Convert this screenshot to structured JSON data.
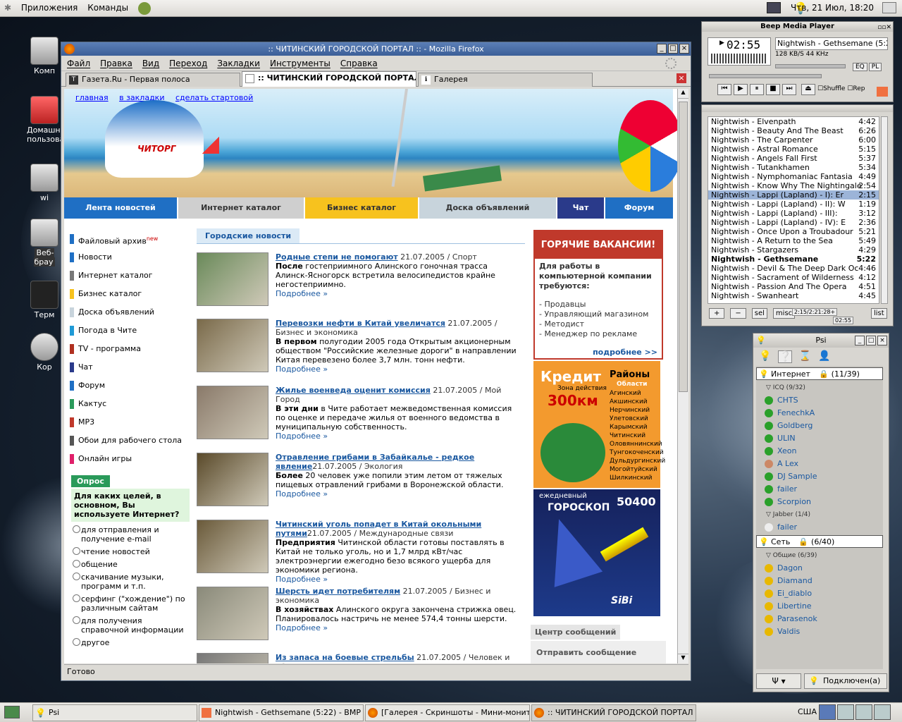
{
  "top_panel": {
    "apps": "Приложения",
    "commands": "Команды",
    "clock": "Чтв, 21 Июл, 18:20"
  },
  "desktop_icons": [
    "Комп",
    "Домашни пользова",
    "Веб-брау",
    "Терм",
    "Кор",
    "wi"
  ],
  "firefox": {
    "title": ":: ЧИТИНСКИЙ ГОРОДСКОЙ ПОРТАЛ :: - Mozilla Firefox",
    "menu": [
      "Файл",
      "Правка",
      "Вид",
      "Переход",
      "Закладки",
      "Инструменты",
      "Справка"
    ],
    "tabs": [
      "Газета.Ru - Первая полоса",
      ":: ЧИТИНСКИЙ ГОРОДСКОЙ ПОРТАЛ ::",
      "Галерея"
    ],
    "status": "Готово"
  },
  "page": {
    "top_links": [
      "главная",
      "в закладки",
      "сделать стартовой"
    ],
    "banner_brand": "ЧИТОРГ",
    "nav": [
      {
        "label": "Лента новостей",
        "bg": "#1f6fc4",
        "fg": "#fff"
      },
      {
        "label": "Интернет каталог",
        "bg": "#cfcfcf",
        "fg": "#333"
      },
      {
        "label": "Бизнес каталог",
        "bg": "#f7c21e",
        "fg": "#333"
      },
      {
        "label": "Доска объявлений",
        "bg": "#c8d4dc",
        "fg": "#333"
      },
      {
        "label": "Чат",
        "bg": "#2a3a8a",
        "fg": "#fff"
      },
      {
        "label": "Форум",
        "bg": "#1f6fc4",
        "fg": "#fff"
      }
    ],
    "left_menu": [
      {
        "label": "Файловый архив",
        "color": "#1f6fc4",
        "badge": "new"
      },
      {
        "label": "Новости",
        "color": "#1f6fc4"
      },
      {
        "label": "Интернет каталог",
        "color": "#777"
      },
      {
        "label": "Бизнес каталог",
        "color": "#f7c21e"
      },
      {
        "label": "Доска объявлений",
        "color": "#c8d4dc"
      },
      {
        "label": "Погода в Чите",
        "color": "#1f9ad6"
      },
      {
        "label": "TV - программа",
        "color": "#b03020"
      },
      {
        "label": "Чат",
        "color": "#2a3a8a"
      },
      {
        "label": "Форум",
        "color": "#1f6fc4"
      },
      {
        "label": "Кактус",
        "color": "#2a9a5a"
      },
      {
        "label": "MP3",
        "color": "#c0392b"
      },
      {
        "label": "Обои для рабочего стола",
        "color": "#555"
      },
      {
        "label": "Онлайн игры",
        "color": "#e0206a"
      }
    ],
    "poll": {
      "header": "Опрос",
      "question": "Для каких целей, в основном, Вы используете Интернет?",
      "options": [
        "для отправления и получение e-mail",
        "чтение новостей",
        "общение",
        "скачивание музыки, программ и т.п.",
        "серфинг (\"хождение\") по различным сайтам",
        "для получения справочной информации",
        "другое"
      ]
    },
    "news_header": "Городские новости",
    "news": [
      {
        "title": "Родные степи не помогают",
        "meta": " 21.07.2005 / Спорт",
        "lead": "После",
        "body": " гостеприимного Алинского гоночная трасса Алинск-Ясногорск встретила велосипедистов крайне негостеприимно.",
        "more": "Подробнее »",
        "thumb": "#6a8a5a"
      },
      {
        "title": "Перевозки нефти в Китай увеличатся",
        "meta": " 21.07.2005 / Бизнес и экономика",
        "lead": "В первом",
        "body": " полугодии 2005 года Открытым акционерным обществом \"Российские железные дороги\" в направлении Китая перевезено более 3,7 млн. тонн нефти.",
        "more": "Подробнее »",
        "thumb": "#7a6a4a"
      },
      {
        "title": "Жилье военведа оценит комиссия",
        "meta": " 21.07.2005 / Мой Город",
        "lead": "В эти дни",
        "body": " в Чите работает межведомственная комиссия по оценке и передаче жилья от военного ведомства в муниципальную собственность.",
        "more": "Подробнее »",
        "thumb": "#8a7a6a"
      },
      {
        "title": "Отравление грибами в Забайкалье - редкое явление",
        "meta": "21.07.2005 / Экология",
        "lead": "Более",
        "body": " 20 человек уже попили этим летом от тяжелых пищевых отравлений грибами в Воронежской области.",
        "more": "Подробнее »",
        "thumb": "#5a4a2a"
      },
      {
        "title": "Читинский уголь попадет в Китай окольными путями",
        "meta": "21.07.2005 / Международные связи",
        "lead": "Предприятия",
        "body": " Читинской области готовы поставлять в Китай не только уголь, но и 1,7 млрд кВт/час электроэнергии ежегодно безо всякого ущерба для экономики региона.",
        "more": "Подробнее »",
        "thumb": "#6a5a3a"
      },
      {
        "title": "Шерсть идет потребителям",
        "meta": " 21.07.2005 / Бизнес и экономика",
        "lead": "В хозяйствах",
        "body": " Алинского округа закончена стрижка овец. Планировалось настричь не менее 574,4 тонны шерсти.",
        "more": "Подробнее »",
        "thumb": "#8a8a7a"
      },
      {
        "title": "Из запаса на боевые стрельбы",
        "meta": " 21.07.2005 / Человек и общество",
        "lead": "",
        "body": "",
        "more": "",
        "thumb": "#777"
      }
    ],
    "vacancies": {
      "header": "ГОРЯЧИЕ ВАКАНСИИ!",
      "intro": "Для работы в компьютерной компании требуются:",
      "items": [
        "- Продавцы",
        "- Управляющий магазином",
        "- Методист",
        "- Менеджер по рекламе"
      ],
      "more": "подробнее >>"
    },
    "kredit": {
      "title": "Кредит",
      "zone": "Зона действия",
      "km": "300км",
      "regions_title": "Районы",
      "regions_sub": "Области",
      "regions": [
        "Агинский",
        "Акшинский",
        "Нерчинский",
        "Улетовский",
        "Карымский",
        "Читинский",
        "Оловяннинский",
        "Тунгокоченский",
        "Дульдургинский",
        "Могойтуйский",
        "Шилкинский"
      ]
    },
    "horo": {
      "daily": "ежедневный",
      "title": "ГОРОСКОП",
      "number": "50400",
      "brand": "SiBi"
    },
    "msg_center": {
      "title": "Центр сообщений",
      "send": "Отправить сообщение"
    }
  },
  "bmp": {
    "title": "Beep Media Player",
    "time": "02:55",
    "track": "Nightwish - Gethsemane (5:22)",
    "info": "128 KB/S  44 KHz",
    "shuffle": "Shuffle",
    "repeat": "Rep",
    "eq": "EQ",
    "pl": "PL"
  },
  "playlist": {
    "tracks": [
      [
        "Nightwish - Elvenpath",
        "4:42"
      ],
      [
        "Nightwish - Beauty And The Beast",
        "6:26"
      ],
      [
        "Nightwish - The Carpenter",
        "6:00"
      ],
      [
        "Nightwish - Astral Romance",
        "5:15"
      ],
      [
        "Nightwish - Angels Fall First",
        "5:37"
      ],
      [
        "Nightwish - Tutankhamen",
        "5:34"
      ],
      [
        "Nightwish - Nymphomaniac Fantasia",
        "4:49"
      ],
      [
        "Nightwish - Know Why The Nightingale",
        "2:54"
      ],
      [
        "Nightwish - Lappi (Lapland) - I): Er",
        "2:15"
      ],
      [
        "Nightwish - Lappi (Lapland) - II): W",
        "1:19"
      ],
      [
        "Nightwish - Lappi (Lapland) - III):",
        "3:12"
      ],
      [
        "Nightwish - Lappi (Lapland) - IV): E",
        "2:36"
      ],
      [
        "Nightwish - Once Upon a Troubadour",
        "5:21"
      ],
      [
        "Nightwish - A Return to the Sea",
        "5:49"
      ],
      [
        "Nightwish - Stargazers",
        "4:29"
      ],
      [
        "Nightwish - Gethsemane",
        "5:22"
      ],
      [
        "Nightwish - Devil & The Deep Dark Oc",
        "4:46"
      ],
      [
        "Nightwish - Sacrament of Wilderness",
        "4:12"
      ],
      [
        "Nightwish - Passion And The Opera",
        "4:51"
      ],
      [
        "Nightwish - Swanheart",
        "4:45"
      ]
    ],
    "selected_index": 8,
    "current_index": 15,
    "buttons": [
      "+",
      "−",
      "sel",
      "misc",
      "list"
    ],
    "time_info": "2:15/2:21:28+",
    "pos": "02:55"
  },
  "psi": {
    "title": "Psi",
    "account1": "Интернет",
    "count1": "(11/39)",
    "group_icq": "ICQ (9/32)",
    "icq_contacts": [
      "CHTS",
      "FenechkA",
      "Goldberg",
      "ULIN",
      "Xeon",
      "A Lex",
      "DJ Sample",
      "failer",
      "Scorpion"
    ],
    "group_jabber": "Jabber (1/4)",
    "jabber_contacts": [
      "failer"
    ],
    "account2": "Сеть",
    "count2": "(6/40)",
    "group_common": "Общие (6/39)",
    "common_contacts": [
      "Dagon",
      "Diamand",
      "Ei_diablo",
      "Libertine",
      "Parasenok",
      "Valdis"
    ],
    "status_btn": "Подключен(а)"
  },
  "taskbar": {
    "items": [
      "Psi",
      "Nightwish - Gethsemane (5:22) - BMP",
      "[Галерея - Скриншоты - Мини-мониторин",
      "::  ЧИТИНСКИЙ ГОРОДСКОЙ ПОРТАЛ :: -"
    ],
    "lang": "США"
  }
}
